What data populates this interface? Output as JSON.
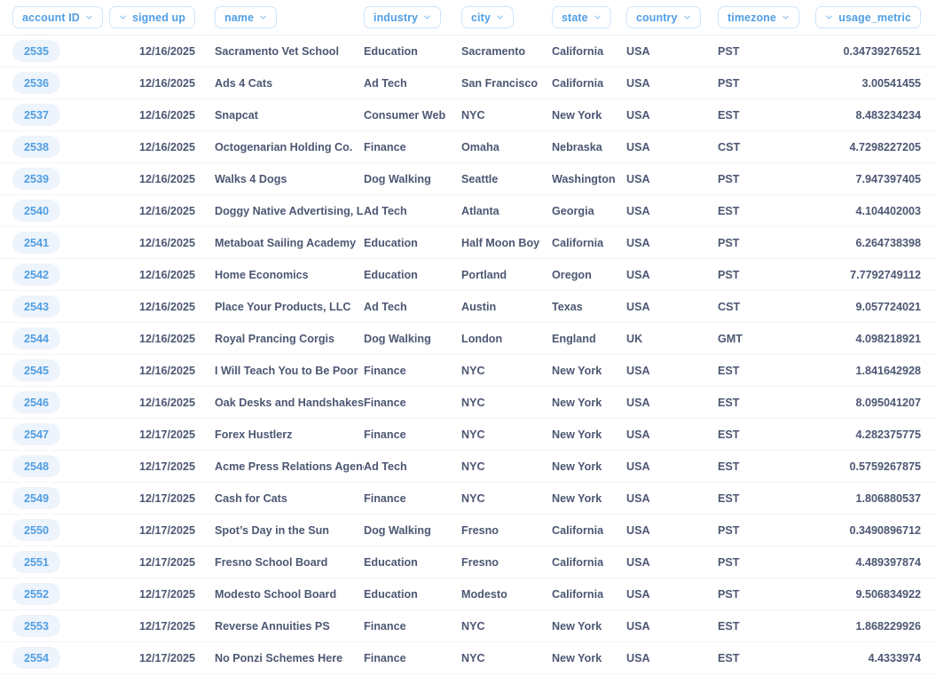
{
  "table": {
    "columns": [
      {
        "key": "account_id",
        "label": "account ID",
        "align": "left",
        "chevron": "right",
        "type": "badge"
      },
      {
        "key": "signed_up",
        "label": "signed up",
        "align": "right",
        "chevron": "left",
        "type": "text"
      },
      {
        "key": "name",
        "label": "name",
        "align": "left",
        "chevron": "right",
        "type": "text"
      },
      {
        "key": "industry",
        "label": "industry",
        "align": "left",
        "chevron": "right",
        "type": "text"
      },
      {
        "key": "city",
        "label": "city",
        "align": "left",
        "chevron": "right",
        "type": "text"
      },
      {
        "key": "state",
        "label": "state",
        "align": "left",
        "chevron": "right",
        "type": "text"
      },
      {
        "key": "country",
        "label": "country",
        "align": "left",
        "chevron": "right",
        "type": "text"
      },
      {
        "key": "timezone",
        "label": "timezone",
        "align": "left",
        "chevron": "right",
        "type": "text"
      },
      {
        "key": "usage_metric",
        "label": "usage_metric",
        "align": "right",
        "chevron": "left",
        "type": "text"
      }
    ],
    "rows": [
      {
        "account_id": "2535",
        "signed_up": "12/16/2025",
        "name": "Sacramento Vet School",
        "industry": "Education",
        "city": "Sacramento",
        "state": "California",
        "country": "USA",
        "timezone": "PST",
        "usage_metric": "0.34739276521"
      },
      {
        "account_id": "2536",
        "signed_up": "12/16/2025",
        "name": "Ads 4 Cats",
        "industry": "Ad Tech",
        "city": "San Francisco",
        "state": "California",
        "country": "USA",
        "timezone": "PST",
        "usage_metric": "3.00541455"
      },
      {
        "account_id": "2537",
        "signed_up": "12/16/2025",
        "name": "Snapcat",
        "industry": "Consumer Web",
        "city": "NYC",
        "state": "New York",
        "country": "USA",
        "timezone": "EST",
        "usage_metric": "8.483234234"
      },
      {
        "account_id": "2538",
        "signed_up": "12/16/2025",
        "name": "Octogenarian Holding Co.",
        "industry": "Finance",
        "city": "Omaha",
        "state": "Nebraska",
        "country": "USA",
        "timezone": "CST",
        "usage_metric": "4.7298227205"
      },
      {
        "account_id": "2539",
        "signed_up": "12/16/2025",
        "name": "Walks 4 Dogs",
        "industry": "Dog Walking",
        "city": "Seattle",
        "state": "Washington",
        "country": "USA",
        "timezone": "PST",
        "usage_metric": "7.947397405"
      },
      {
        "account_id": "2540",
        "signed_up": "12/16/2025",
        "name": "Doggy Native Advertising, LLC.",
        "industry": "Ad Tech",
        "city": "Atlanta",
        "state": "Georgia",
        "country": "USA",
        "timezone": "EST",
        "usage_metric": "4.104402003"
      },
      {
        "account_id": "2541",
        "signed_up": "12/16/2025",
        "name": "Metaboat Sailing Academy",
        "industry": "Education",
        "city": "Half Moon Boy",
        "state": "California",
        "country": "USA",
        "timezone": "PST",
        "usage_metric": "6.264738398"
      },
      {
        "account_id": "2542",
        "signed_up": "12/16/2025",
        "name": "Home Economics",
        "industry": "Education",
        "city": "Portland",
        "state": "Oregon",
        "country": "USA",
        "timezone": "PST",
        "usage_metric": "7.7792749112"
      },
      {
        "account_id": "2543",
        "signed_up": "12/16/2025",
        "name": "Place Your Products, LLC",
        "industry": "Ad Tech",
        "city": "Austin",
        "state": "Texas",
        "country": "USA",
        "timezone": "CST",
        "usage_metric": "9.057724021"
      },
      {
        "account_id": "2544",
        "signed_up": "12/16/2025",
        "name": "Royal Prancing Corgis",
        "industry": "Dog Walking",
        "city": "London",
        "state": "England",
        "country": "UK",
        "timezone": "GMT",
        "usage_metric": "4.098218921"
      },
      {
        "account_id": "2545",
        "signed_up": "12/16/2025",
        "name": "I Will Teach You to Be Poor",
        "industry": "Finance",
        "city": "NYC",
        "state": "New York",
        "country": "USA",
        "timezone": "EST",
        "usage_metric": "1.841642928"
      },
      {
        "account_id": "2546",
        "signed_up": "12/16/2025",
        "name": "Oak Desks and Handshakes",
        "industry": "Finance",
        "city": "NYC",
        "state": "New York",
        "country": "USA",
        "timezone": "EST",
        "usage_metric": "8.095041207"
      },
      {
        "account_id": "2547",
        "signed_up": "12/17/2025",
        "name": "Forex Hustlerz",
        "industry": "Finance",
        "city": "NYC",
        "state": "New York",
        "country": "USA",
        "timezone": "EST",
        "usage_metric": "4.282375775"
      },
      {
        "account_id": "2548",
        "signed_up": "12/17/2025",
        "name": "Acme Press Relations Agency",
        "industry": "Ad Tech",
        "city": "NYC",
        "state": "New York",
        "country": "USA",
        "timezone": "EST",
        "usage_metric": "0.5759267875"
      },
      {
        "account_id": "2549",
        "signed_up": "12/17/2025",
        "name": "Cash for Cats",
        "industry": "Finance",
        "city": "NYC",
        "state": "New York",
        "country": "USA",
        "timezone": "EST",
        "usage_metric": "1.806880537"
      },
      {
        "account_id": "2550",
        "signed_up": "12/17/2025",
        "name": "Spot’s Day in the Sun",
        "industry": "Dog Walking",
        "city": "Fresno",
        "state": "California",
        "country": "USA",
        "timezone": "PST",
        "usage_metric": "0.3490896712"
      },
      {
        "account_id": "2551",
        "signed_up": "12/17/2025",
        "name": "Fresno School Board",
        "industry": "Education",
        "city": "Fresno",
        "state": "California",
        "country": "USA",
        "timezone": "PST",
        "usage_metric": "4.489397874"
      },
      {
        "account_id": "2552",
        "signed_up": "12/17/2025",
        "name": "Modesto School Board",
        "industry": "Education",
        "city": "Modesto",
        "state": "California",
        "country": "USA",
        "timezone": "PST",
        "usage_metric": "9.506834922"
      },
      {
        "account_id": "2553",
        "signed_up": "12/17/2025",
        "name": "Reverse Annuities PS",
        "industry": "Finance",
        "city": "NYC",
        "state": "New York",
        "country": "USA",
        "timezone": "EST",
        "usage_metric": "1.868229926"
      },
      {
        "account_id": "2554",
        "signed_up": "12/17/2025",
        "name": "No Ponzi Schemes Here",
        "industry": "Finance",
        "city": "NYC",
        "state": "New York",
        "country": "USA",
        "timezone": "EST",
        "usage_metric": "4.4333974"
      }
    ]
  },
  "colors": {
    "accent": "#509ee3",
    "text": "#4c5773",
    "badge_bg": "#edf4fc",
    "pill_border": "#cfe4fb",
    "row_border": "#f3f4f6",
    "header_border": "#eaecf0",
    "background": "#ffffff"
  },
  "icons": {
    "chevron_down": "chevron-down-icon"
  }
}
